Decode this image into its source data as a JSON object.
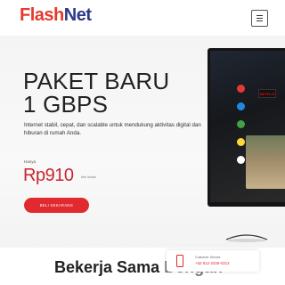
{
  "brand": {
    "name_part1": "Flash",
    "name_part2": "Net"
  },
  "header": {
    "menu_icon": "hamburger-icon"
  },
  "hero": {
    "title_line1": "PAKET BARU",
    "title_line2": "1 GBPS",
    "description": "Internet stabil, cepat, dan scalable untuk mendukung aktivitas digital dan hiburan di rumah Anda.",
    "price_prefix": "Hanya",
    "price": "Rp910",
    "price_unit": "ribu /bulan",
    "cta_label": "BELI SEKARANG"
  },
  "tv": {
    "netflix_label": "NETFLIX"
  },
  "section": {
    "title_visible": "Bekerja Sama",
    "title_partial": "Dengan"
  },
  "customer_service": {
    "label": "Customer Service",
    "phone": "+62 812-2325-0313",
    "icon": "phone-icon"
  },
  "colors": {
    "accent_red": "#e02a2f",
    "brand_blue": "#2b3a8a",
    "price_red": "#c8262f"
  }
}
